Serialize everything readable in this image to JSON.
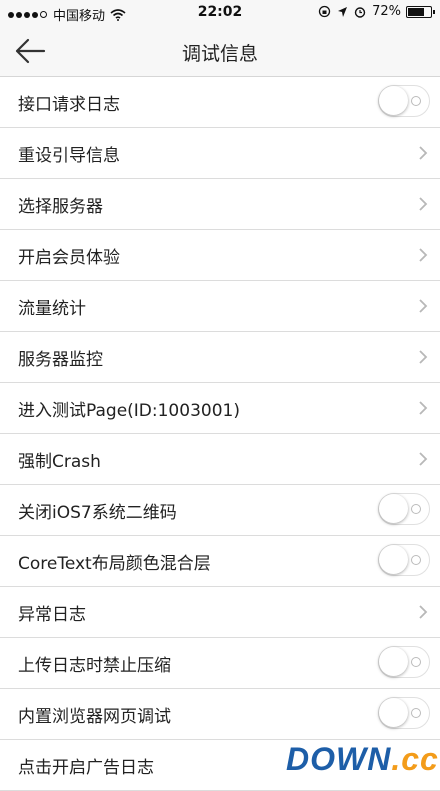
{
  "status_bar": {
    "carrier": "中国移动",
    "time": "22:02",
    "battery": "72%",
    "battery_level": 0.72
  },
  "nav": {
    "title": "调试信息",
    "back_icon": "arrow-left-icon"
  },
  "rows": [
    {
      "label": "接口请求日志",
      "control": "toggle",
      "on": false
    },
    {
      "label": "重设引导信息",
      "control": "chevron"
    },
    {
      "label": "选择服务器",
      "control": "chevron"
    },
    {
      "label": "开启会员体验",
      "control": "chevron"
    },
    {
      "label": "流量统计",
      "control": "chevron"
    },
    {
      "label": "服务器监控",
      "control": "chevron"
    },
    {
      "label": "进入测试Page(ID:1003001)",
      "control": "chevron"
    },
    {
      "label": "强制Crash",
      "control": "chevron"
    },
    {
      "label": "关闭iOS7系统二维码",
      "control": "toggle",
      "on": false
    },
    {
      "label": "CoreText布局颜色混合层",
      "control": "toggle",
      "on": false
    },
    {
      "label": "异常日志",
      "control": "chevron"
    },
    {
      "label": "上传日志时禁止压缩",
      "control": "toggle",
      "on": false
    },
    {
      "label": "内置浏览器网页调试",
      "control": "toggle",
      "on": false
    },
    {
      "label": "点击开启广告日志",
      "control": "none"
    }
  ],
  "watermark": {
    "main": "DOWN",
    "suffix": ".cc"
  },
  "colors": {
    "watermark_blue": "#1d5ea8",
    "watermark_orange": "#f39c1a"
  }
}
